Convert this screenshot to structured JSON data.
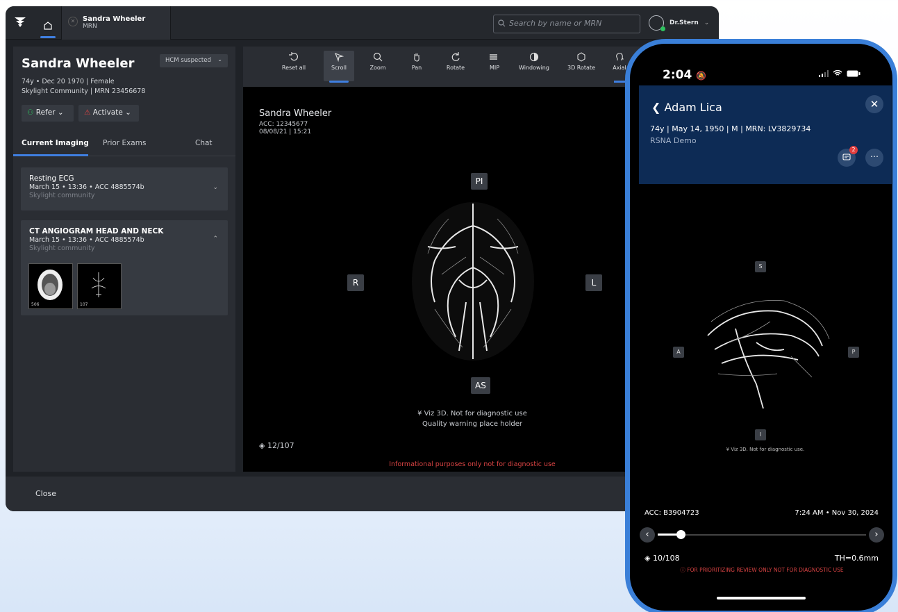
{
  "app": {
    "patient_tab_name": "Sandra Wheeler",
    "patient_tab_sub": "MRN",
    "search_placeholder": "Search by name or MRN",
    "user": "Dr.Stern"
  },
  "patient": {
    "name": "Sandra Wheeler",
    "line1": "74y • Dec 20 1970 | Female",
    "line2": "Skylight Community | MRN 23456678",
    "tag": "HCM suspected"
  },
  "actions": {
    "refer": "Refer",
    "activate": "Activate"
  },
  "tabs": [
    "Current Imaging",
    "Prior Exams",
    "Chat"
  ],
  "studies": [
    {
      "title": "Resting ECG",
      "meta": "March 15 • 13:36 • ACC 4885574b",
      "site": "Skylight community"
    },
    {
      "title": "CT ANGIOGRAM HEAD AND NECK",
      "meta": "March 15 • 13:36 • ACC 4885574b",
      "site": "Skylight community",
      "thumbs": [
        "506",
        "107"
      ]
    }
  ],
  "footer": {
    "close": "Close"
  },
  "tools": [
    "Reset all",
    "Scroll",
    "Zoom",
    "Pan",
    "Rotate",
    "MIP",
    "Windowing",
    "3D Rotate",
    "Axial"
  ],
  "viewer": {
    "name": "Sandra Wheeler",
    "acc": "ACC: 12345677",
    "date": "08/08/21 | 15:21",
    "top": "PI",
    "bottom": "AS",
    "left": "R",
    "right": "L",
    "disclaimer1": "Viz 3D. Not for diagnostic use",
    "disclaimer2": "Quality warning place holder",
    "slices": "12/107",
    "warning": "Informational purposes only not for diagnostic use"
  },
  "phone": {
    "time": "2:04",
    "name": "Adam Lica",
    "meta": "74y | May 14, 1950 | M | MRN: LV3829734",
    "site": "RSNA Demo",
    "badge": "2",
    "top": "S",
    "bottom": "I",
    "left": "A",
    "right": "P",
    "disclaimer": "Viz 3D. Not for diagnostic use.",
    "acc": "ACC: B3904723",
    "datetime": "7:24 AM • Nov 30, 2024",
    "slices": "10/108",
    "th": "TH=0.6mm",
    "warning": "FOR PRIORITIZING REVIEW ONLY NOT FOR DIAGNOSTIC USE",
    "slider_position": 0.08
  },
  "colors": {
    "accent": "#3f7fe0",
    "warning": "#d84343",
    "phone_frame": "#3a7fd8",
    "phone_header": "#0d2b55"
  }
}
